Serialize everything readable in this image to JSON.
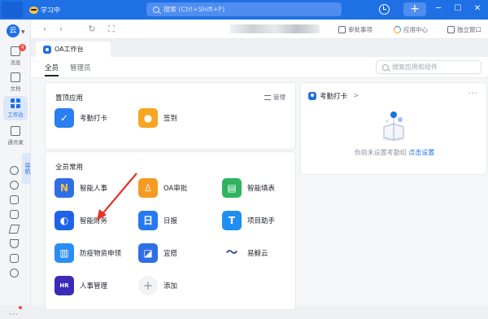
{
  "topbar": {
    "status": "学习中",
    "search_placeholder": "搜索 (Ctrl+Shift+F)",
    "plus": "+",
    "min": "─",
    "max": "☐",
    "close": "✕"
  },
  "sidebar": {
    "avatar": "云",
    "items": [
      {
        "label": "消息",
        "badge": "4"
      },
      {
        "label": "文档"
      },
      {
        "label": "工作台",
        "active": true
      },
      {
        "label": "通讯录"
      }
    ],
    "vertical_tab": "导航"
  },
  "addressbar": {
    "back": "‹",
    "forward": "›",
    "refresh": "↻",
    "expand": "⛶",
    "actions": [
      "审批事项",
      "应用中心",
      "独立窗口"
    ]
  },
  "tab": {
    "title": "OA工作台"
  },
  "subtabs": [
    "全员",
    "管理员"
  ],
  "search_app_placeholder": "搜索应用和组件",
  "pinned_card": {
    "title": "置顶应用",
    "manage": "管理",
    "apps": [
      {
        "label": "考勤打卡",
        "color": "#2a7ef0"
      },
      {
        "label": "签到",
        "color": "#f5a623"
      }
    ]
  },
  "common_card": {
    "title": "全员常用",
    "apps": [
      {
        "label": "智能人事",
        "color": "#2f6fe6"
      },
      {
        "label": "OA审批",
        "color": "#f59a23"
      },
      {
        "label": "智能填表",
        "color": "#2fb35f"
      },
      {
        "label": "智能财务",
        "color": "#1f64e8"
      },
      {
        "label": "日报",
        "color": "#2878f0"
      },
      {
        "label": "项目助手",
        "color": "#1f8ff0"
      },
      {
        "label": "防疫物资申领",
        "color": "#2a8cf5"
      },
      {
        "label": "宜搭",
        "color": "#2f6fe6"
      },
      {
        "label": "易鲸云",
        "color": "#ffffff"
      },
      {
        "label": "人事管理",
        "color": "#3b2bb8"
      },
      {
        "label": "添加",
        "color": "#f2f3f5"
      }
    ]
  },
  "attendance_card": {
    "title": "考勤打卡",
    "chevron": ">",
    "more": "···",
    "empty_text": "你尚未设置考勤组",
    "link": "点击设置"
  },
  "colors": {
    "accent": "#1f6fe5",
    "annotation_arrow": "#e5332a"
  }
}
